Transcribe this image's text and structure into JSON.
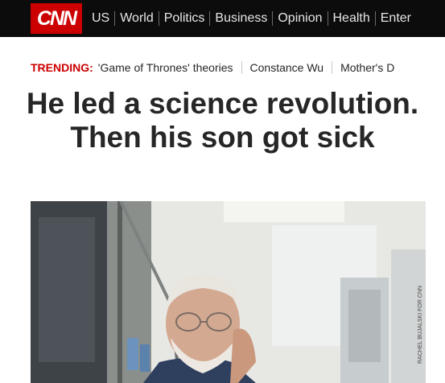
{
  "header": {
    "logo_text": "CNN",
    "nav_items": [
      "US",
      "World",
      "Politics",
      "Business",
      "Opinion",
      "Health",
      "Enter"
    ]
  },
  "trending": {
    "label": "TRENDING:",
    "items": [
      "'Game of Thrones' theories",
      "Constance Wu",
      "Mother's D"
    ]
  },
  "article": {
    "headline": "He led a science revolution. Then his son got sick",
    "photo_credit": "RACHEL BUJALSKI FOR CNN"
  },
  "colors": {
    "brand_red": "#cc0000",
    "nav_bg": "#0c0c0c",
    "headline_text": "#262626"
  }
}
